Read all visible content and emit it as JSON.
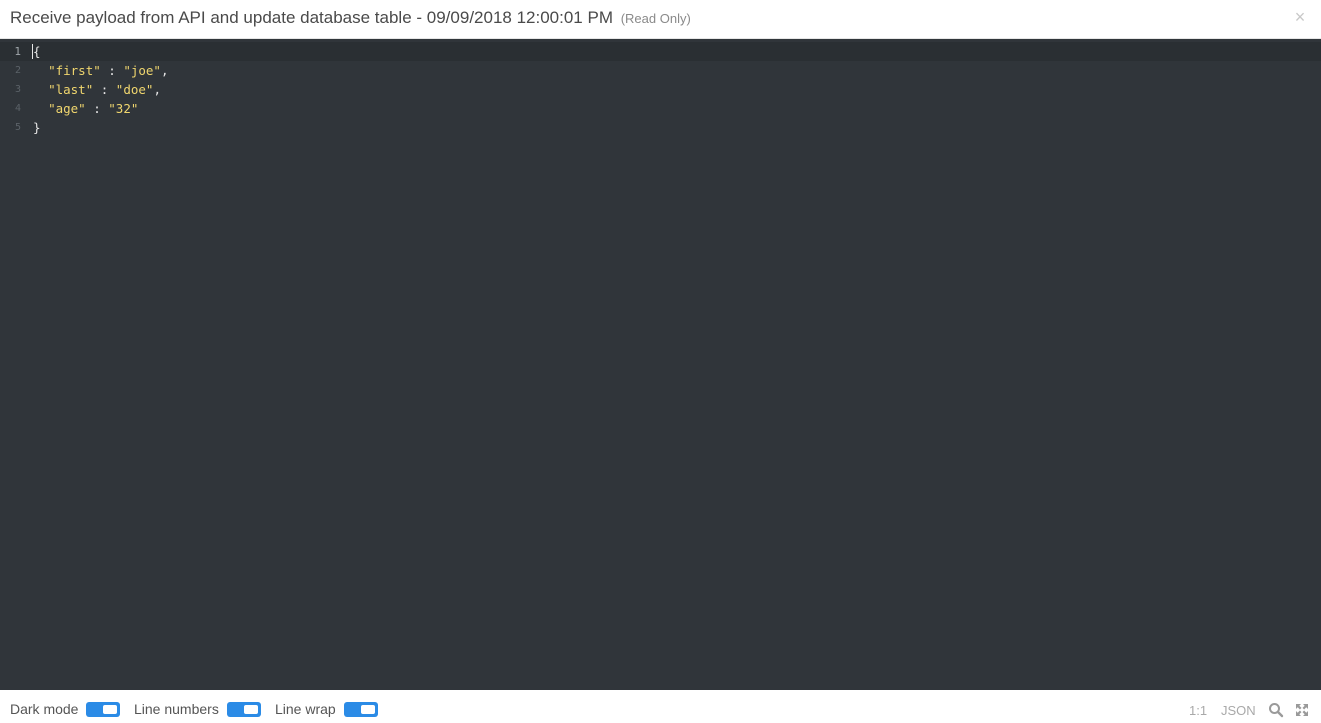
{
  "header": {
    "title": "Receive payload from API and update database table - 09/09/2018 12:00:01 PM",
    "read_only": "(Read Only)",
    "close_glyph": "×"
  },
  "editor": {
    "line_numbers": [
      "1",
      "2",
      "3",
      "4",
      "5"
    ],
    "lines": [
      {
        "key": "",
        "value": "",
        "text": "{"
      },
      {
        "key": "\"first\"",
        "sep": " : ",
        "value": "\"joe\"",
        "end": ","
      },
      {
        "key": "\"last\"",
        "sep": " : ",
        "value": "\"doe\"",
        "end": ","
      },
      {
        "key": "\"age\"",
        "sep": " : ",
        "value": "\"32\"",
        "end": ""
      },
      {
        "key": "",
        "value": "",
        "text": "}"
      }
    ],
    "colors": {
      "background": "#30353a",
      "string": "#f0d66e",
      "text": "#e6e6e6"
    }
  },
  "footer": {
    "options": [
      {
        "label": "Dark mode",
        "on": true
      },
      {
        "label": "Line numbers",
        "on": true
      },
      {
        "label": "Line wrap",
        "on": true
      }
    ],
    "cursor_position": "1:1",
    "language": "JSON",
    "search_icon": "search-icon",
    "fullscreen_icon": "fullscreen-icon",
    "accent": "#2b8be6"
  }
}
